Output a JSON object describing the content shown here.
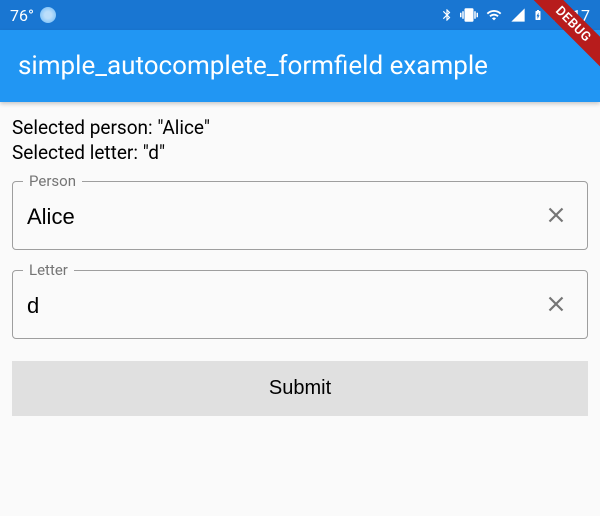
{
  "statusBar": {
    "temperature": "76°",
    "time": "12:17"
  },
  "appBar": {
    "title": "simple_autocomplete_formfield example"
  },
  "debugBanner": "DEBUG",
  "status": {
    "personLabel": "Selected person:",
    "personValue": "\"Alice\"",
    "letterLabel": "Selected letter:",
    "letterValue": "\"d\""
  },
  "fields": {
    "person": {
      "label": "Person",
      "value": "Alice"
    },
    "letter": {
      "label": "Letter",
      "value": "d"
    }
  },
  "submit": {
    "label": "Submit"
  }
}
